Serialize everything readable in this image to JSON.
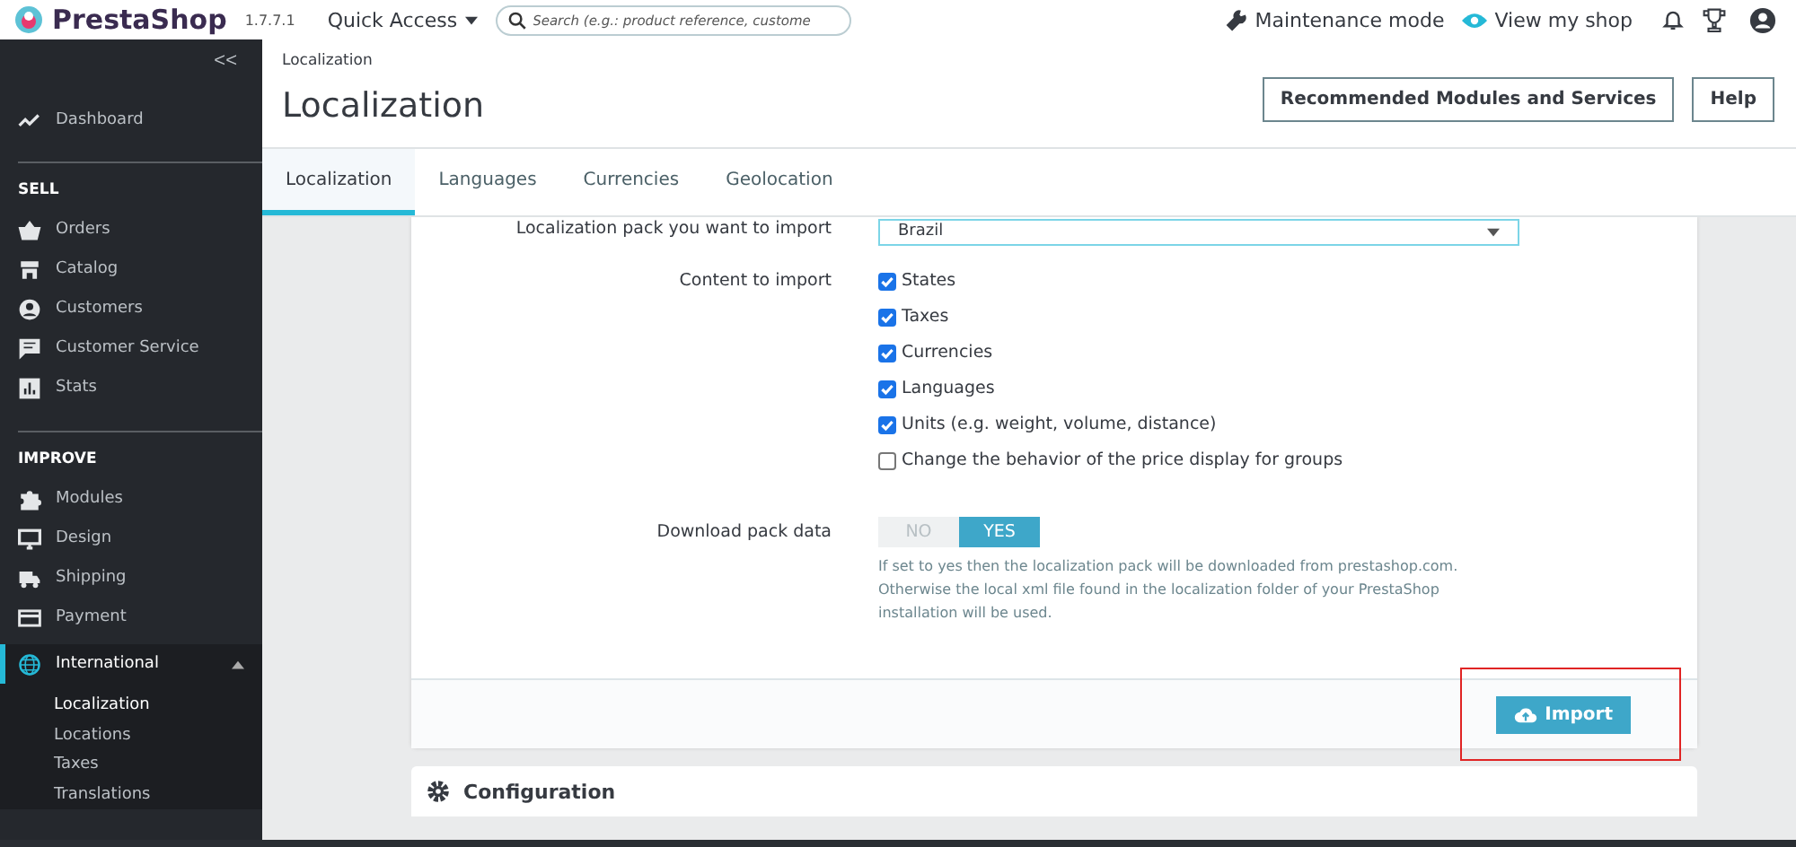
{
  "header": {
    "brand": "PrestaShop",
    "version": "1.7.7.1",
    "quick_access": "Quick Access",
    "search": {
      "placeholder": "Search (e.g.: product reference, custome"
    },
    "maintenance": "Maintenance mode",
    "view_shop": "View my shop"
  },
  "sidebar": {
    "collapse": "<<",
    "items": [
      {
        "kind": "item",
        "label": "Dashboard",
        "selected": false
      },
      {
        "kind": "section",
        "label": "SELL"
      },
      {
        "kind": "item",
        "label": "Orders",
        "selected": false
      },
      {
        "kind": "item",
        "label": "Catalog",
        "selected": false
      },
      {
        "kind": "item",
        "label": "Customers",
        "selected": false
      },
      {
        "kind": "item",
        "label": "Customer Service",
        "selected": false
      },
      {
        "kind": "item",
        "label": "Stats",
        "selected": false
      },
      {
        "kind": "section",
        "label": "IMPROVE"
      },
      {
        "kind": "item",
        "label": "Modules",
        "selected": false
      },
      {
        "kind": "item",
        "label": "Design",
        "selected": false
      },
      {
        "kind": "item",
        "label": "Shipping",
        "selected": false
      },
      {
        "kind": "item",
        "label": "Payment",
        "selected": false
      },
      {
        "kind": "item",
        "label": "International",
        "selected": true,
        "expanded": true,
        "children": [
          {
            "label": "Localization",
            "selected": true
          },
          {
            "label": "Locations",
            "selected": false
          },
          {
            "label": "Taxes",
            "selected": false
          },
          {
            "label": "Translations",
            "selected": false
          }
        ]
      }
    ]
  },
  "page": {
    "breadcrumb": "Localization",
    "title": "Localization",
    "buttons": [
      "Recommended Modules and Services",
      "Help"
    ]
  },
  "tabs": [
    {
      "label": "Localization",
      "selected": true
    },
    {
      "label": "Languages",
      "selected": false
    },
    {
      "label": "Currencies",
      "selected": false
    },
    {
      "label": "Geolocation",
      "selected": false
    }
  ],
  "form": {
    "pack_label": "Localization pack you want to import",
    "pack_value": "Brazil",
    "content_label": "Content to import",
    "options": [
      {
        "label": "States",
        "checked": true
      },
      {
        "label": "Taxes",
        "checked": true
      },
      {
        "label": "Currencies",
        "checked": true
      },
      {
        "label": "Languages",
        "checked": true
      },
      {
        "label": "Units (e.g. weight, volume, distance)",
        "checked": true
      },
      {
        "label": "Change the behavior of the price display for groups",
        "checked": false
      }
    ],
    "download_label": "Download pack data",
    "download_toggle": [
      {
        "label": "NO",
        "selected": false
      },
      {
        "label": "YES",
        "selected": true
      }
    ],
    "download_help": "If set to yes then the localization pack will be downloaded from prestashop.com. Otherwise the local xml file found in the localization folder of your PrestaShop installation will be used.",
    "import_button": "Import"
  },
  "configuration": {
    "title": "Configuration"
  }
}
